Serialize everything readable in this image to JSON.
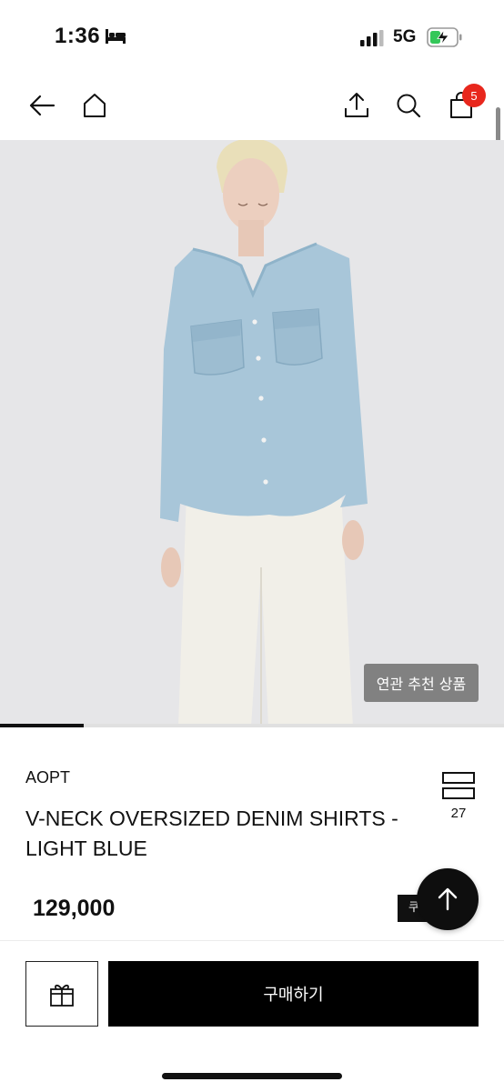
{
  "status_bar": {
    "time": "1:36",
    "network": "5G",
    "icons": [
      "bed-icon",
      "signal-icon",
      "battery-charging-icon"
    ]
  },
  "nav": {
    "icons": [
      "back-arrow-icon",
      "home-icon",
      "share-icon",
      "search-icon",
      "shopping-bag-icon"
    ],
    "cart_count": "5"
  },
  "gallery": {
    "related_label": "연관 추천 상품",
    "progress": 0.166
  },
  "product": {
    "brand": "AOPT",
    "name": "V-NECK OVERSIZED DENIM SHIRTS - LIGHT BLUE",
    "price": "129,000",
    "like_count": "27",
    "coupon_label": "쿠",
    "colors": {
      "denim": "#a8c6d9",
      "pants": "#f1efe8",
      "background": "#e6e6e8"
    }
  },
  "actions": {
    "gift_icon": "gift-icon",
    "buy_label": "구매하기",
    "scroll_top_icon": "arrow-up-icon"
  },
  "colors": {
    "badge": "#e8271d",
    "primary": "#000000"
  }
}
